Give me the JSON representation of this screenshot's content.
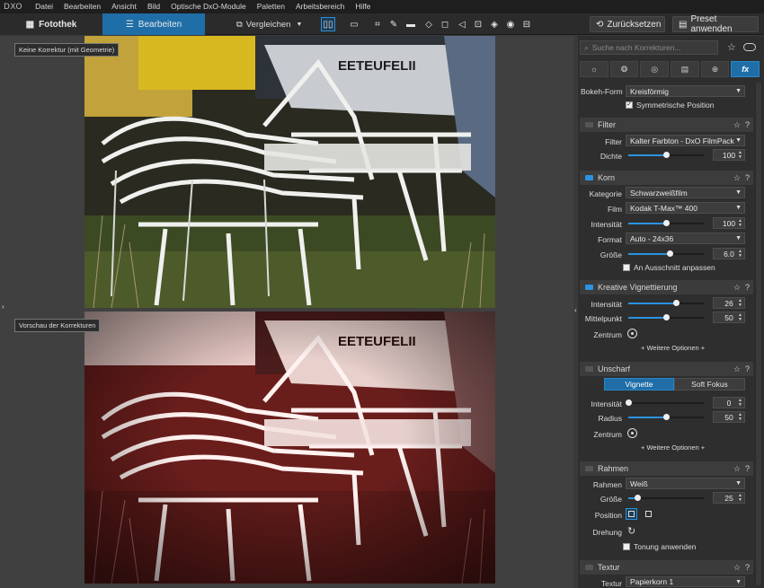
{
  "app": {
    "logo": "DXO"
  },
  "menu": [
    "Datei",
    "Bearbeiten",
    "Ansicht",
    "Bild",
    "Optische DxO-Module",
    "Paletten",
    "Arbeitsbereich",
    "Hilfe"
  ],
  "tabs": {
    "library": "Fotothek",
    "edit": "Bearbeiten"
  },
  "toolbar": {
    "compare": "Vergleichen",
    "reset": "Zurücksetzen",
    "apply_preset": "Preset anwenden"
  },
  "captions": {
    "before": "Keine Korrektur (mit Geometrie)",
    "after": "Vorschau der Korrekturen"
  },
  "search": {
    "placeholder": "Suche nach Korrekturen..."
  },
  "bokeh": {
    "label": "Bokeh-Form",
    "value": "Kreisförmig",
    "symmetric": "Symmetrische Position"
  },
  "filter": {
    "title": "Filter",
    "filter_label": "Filter",
    "filter_value": "Kalter Farbton - DxO FilmPack",
    "density_label": "Dichte",
    "density": 100
  },
  "grain": {
    "title": "Korn",
    "category_label": "Kategorie",
    "category_value": "Schwarzweißfilm",
    "film_label": "Film",
    "film_value": "Kodak T-Max™ 400",
    "intensity_label": "Intensität",
    "intensity": 100,
    "format_label": "Format",
    "format_value": "Auto - 24x36",
    "size_label": "Größe",
    "size": "6.0",
    "fit_crop": "An Ausschnitt anpassen"
  },
  "vignette": {
    "title": "Kreative Vignettierung",
    "intensity_label": "Intensität",
    "intensity": 26,
    "midpoint_label": "Mittelpunkt",
    "midpoint": 50,
    "center_label": "Zentrum",
    "more": "+ Weitere Optionen +"
  },
  "blur": {
    "title": "Unscharf",
    "seg_vignette": "Vignette",
    "seg_soft": "Soft Fokus",
    "intensity_label": "Intensität",
    "intensity": 0,
    "radius_label": "Radius",
    "radius": 50,
    "center_label": "Zentrum",
    "more": "+ Weitere Optionen +"
  },
  "frame": {
    "title": "Rahmen",
    "frame_label": "Rahmen",
    "frame_value": "Weiß",
    "size_label": "Größe",
    "size": 25,
    "position_label": "Position",
    "rotation_label": "Drehung",
    "toning": "Tonung anwenden"
  },
  "texture": {
    "title": "Textur",
    "texture_label": "Textur",
    "texture_value": "Papierkorn 1"
  }
}
